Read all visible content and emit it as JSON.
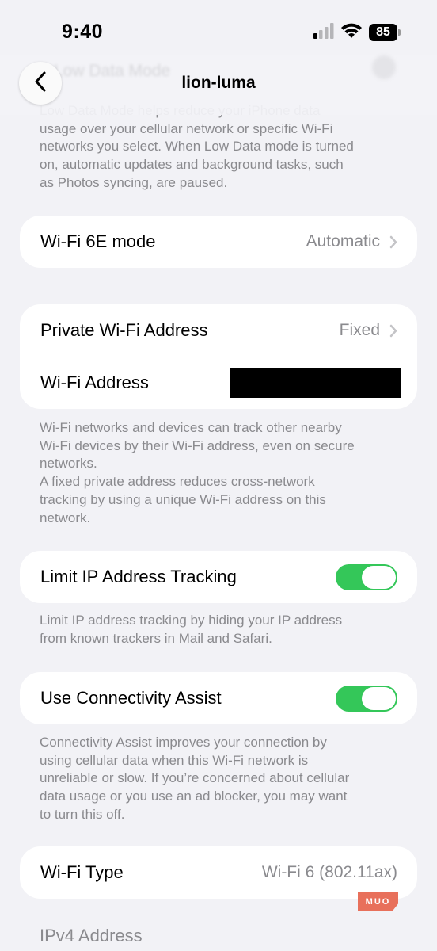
{
  "status_bar": {
    "time": "9:40",
    "battery": "85",
    "icons": [
      "cellular-signal-icon",
      "wifi-icon",
      "battery-icon"
    ]
  },
  "nav": {
    "title": "lion-luma",
    "back_icon": "chevron-left-icon"
  },
  "low_data_footer": "Low Data Mode helps reduce your iPhone data\nusage over your cellular network or specific Wi-Fi\nnetworks you select. When Low Data mode is turned\non, automatic updates and background tasks, such\nas Photos syncing, are paused.",
  "wifi_6e": {
    "label": "Wi-Fi 6E mode",
    "value": "Automatic"
  },
  "private_address": {
    "label": "Private Wi-Fi Address",
    "value": "Fixed"
  },
  "wifi_address": {
    "label": "Wi-Fi Address"
  },
  "address_footer": "Wi-Fi networks and devices can track other nearby\nWi-Fi devices by their Wi-Fi address, even on secure\nnetworks.\nA fixed private address reduces cross-network\ntracking by using a unique Wi-Fi address on this\nnetwork.",
  "limit_ip": {
    "label": "Limit IP Address Tracking",
    "enabled": true
  },
  "limit_ip_footer": "Limit IP address tracking by hiding your IP address\nfrom known trackers in Mail and Safari.",
  "connectivity_assist": {
    "label": "Use Connectivity Assist",
    "enabled": true
  },
  "connectivity_footer": "Connectivity Assist improves your connection by\nusing cellular data when this Wi-Fi network is\nunreliable or slow. If you’re concerned about cellular\ndata usage or you use an ad blocker, you may want\nto turn this off.",
  "wifi_type": {
    "label": "Wi-Fi Type",
    "value": "Wi-Fi 6 (802.11ax)"
  },
  "ipv4_header": "IPv4 Address",
  "watermark": "MUO",
  "colors": {
    "background": "#f2f2f6",
    "toggle_on": "#34c759",
    "secondary_text": "#8a8a8e",
    "watermark": "#e8705b"
  }
}
